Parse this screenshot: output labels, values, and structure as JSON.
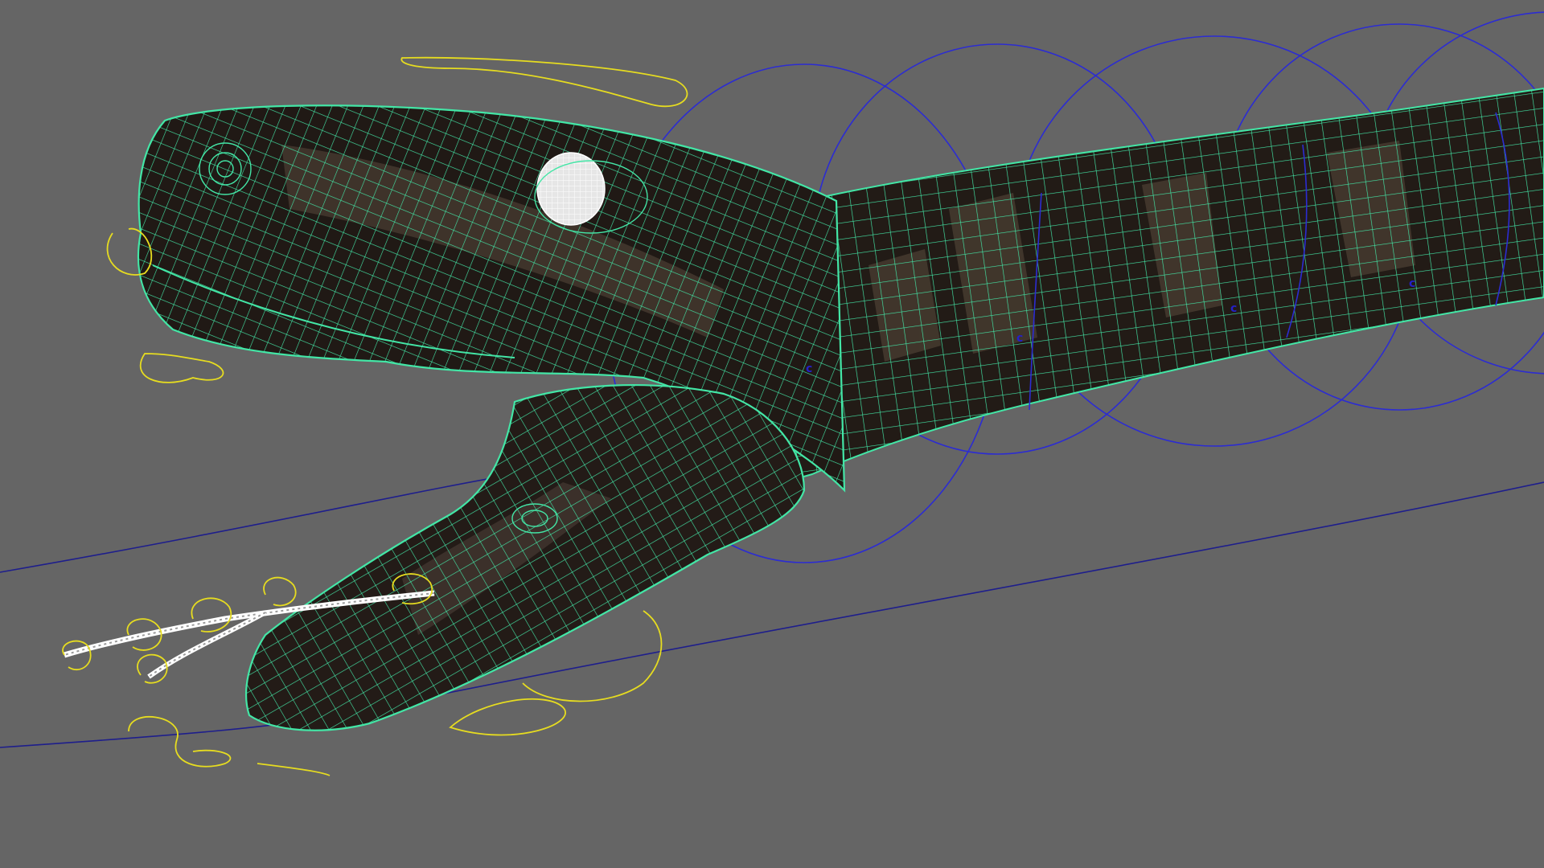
{
  "viewport": {
    "background": "#656565",
    "shaded_view": true,
    "wireframe_on_shaded": true
  },
  "colors": {
    "mesh_wire": "#43e6a6",
    "mesh_skin": "#2a221c",
    "mesh_band": "#4a3e32",
    "eye_wire": "#ffffff",
    "tongue_wire": "#ffffff",
    "spine_control": "#2c2cd2",
    "ground_curve": "#1e1e8c",
    "face_control": "#e6dc20"
  },
  "rig": {
    "object": "snake",
    "joint_markers": [
      "c",
      "c",
      "c",
      "c"
    ],
    "spine_control_count": 5,
    "face_control_count": 9
  }
}
